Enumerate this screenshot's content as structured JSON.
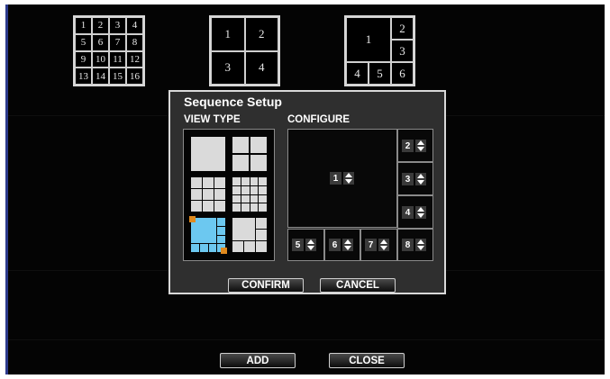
{
  "layouts": {
    "sixteen": [
      "1",
      "2",
      "3",
      "4",
      "5",
      "6",
      "7",
      "8",
      "9",
      "10",
      "11",
      "12",
      "13",
      "14",
      "15",
      "16"
    ],
    "four": [
      "1",
      "2",
      "3",
      "4"
    ],
    "six": [
      "1",
      "2",
      "3",
      "4",
      "5",
      "6"
    ]
  },
  "dialog": {
    "title": "Sequence Setup",
    "view_type_label": "VIEW TYPE",
    "configure_label": "CONFIGURE",
    "view_types": [
      "single",
      "quad",
      "grid-9",
      "grid-16",
      "split-8-selected",
      "split-6"
    ],
    "selected_view_type": "split-8",
    "channels": [
      "1",
      "2",
      "3",
      "4",
      "5",
      "6",
      "7",
      "8"
    ],
    "confirm_label": "CONFIRM",
    "cancel_label": "CANCEL"
  },
  "footer": {
    "add_label": "ADD",
    "close_label": "CLOSE"
  },
  "colors": {
    "background": "#040404",
    "dialog": "#2f2f2f",
    "selected": "#6cc8f0",
    "corner_marker": "#e08a1e",
    "left_edge": "#2c3a8c"
  }
}
